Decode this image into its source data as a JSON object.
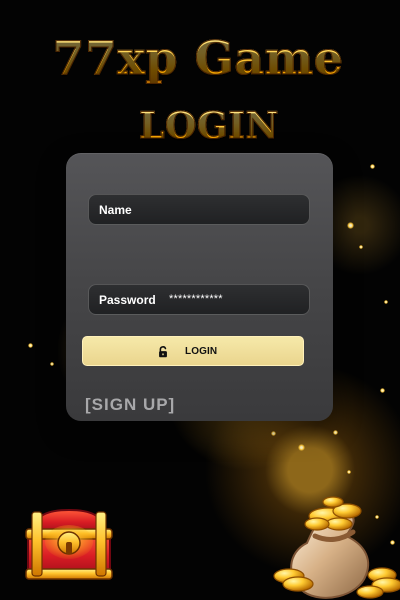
{
  "header": {
    "title": "77xp Game",
    "subtitle": "LOGIN"
  },
  "form": {
    "name_label": "Name",
    "password_label": "Password",
    "password_value": "************",
    "login_button_label": "LOGIN",
    "signup_label": "[SIGN UP]"
  },
  "icons": {
    "lock": "lock-icon",
    "chest": "treasure-chest-icon",
    "coin_bag": "coin-bag-icon"
  },
  "colors": {
    "title_gold": "#ffd34f",
    "button_yellow": "#f3e39f",
    "card_gray": "#4a4a4c"
  }
}
